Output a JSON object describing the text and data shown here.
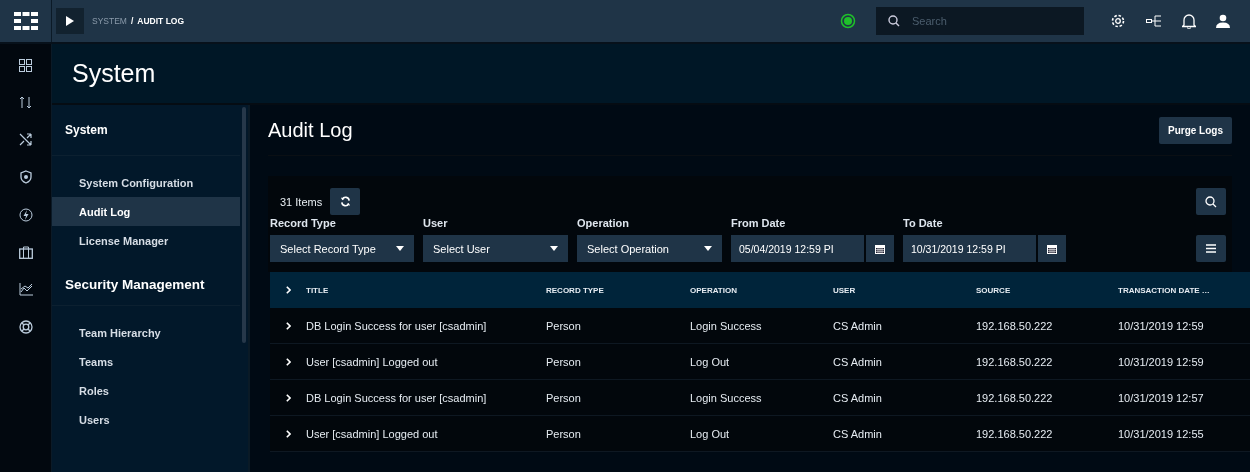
{
  "breadcrumb": {
    "parent": "SYSTEM",
    "separator": "/",
    "current": "AUDIT LOG"
  },
  "search": {
    "placeholder": "Search"
  },
  "page_title": "System",
  "sidebar": {
    "sections": [
      {
        "title": "System",
        "items": [
          {
            "label": "System Configuration",
            "selected": false
          },
          {
            "label": "Audit Log",
            "selected": true
          },
          {
            "label": "License Manager",
            "selected": false
          }
        ]
      },
      {
        "title": "Security Management",
        "items": [
          {
            "label": "Team Hierarchy",
            "selected": false
          },
          {
            "label": "Teams",
            "selected": false
          },
          {
            "label": "Roles",
            "selected": false
          },
          {
            "label": "Users",
            "selected": false
          }
        ]
      }
    ]
  },
  "content": {
    "title": "Audit Log",
    "purge_button": "Purge Logs",
    "item_count": "31 Items",
    "filters": [
      {
        "kind": "select",
        "label": "Record Type",
        "value": "Select Record Type"
      },
      {
        "kind": "select",
        "label": "User",
        "value": "Select User"
      },
      {
        "kind": "select",
        "label": "Operation",
        "value": "Select Operation"
      },
      {
        "kind": "date",
        "label": "From Date",
        "value": "05/04/2019 12:59 PI"
      },
      {
        "kind": "date",
        "label": "To Date",
        "value": "10/31/2019 12:59 PI"
      }
    ]
  },
  "table": {
    "columns": [
      "TITLE",
      "RECORD TYPE",
      "OPERATION",
      "USER",
      "SOURCE",
      "TRANSACTION DATE …"
    ],
    "rows": [
      [
        "DB Login Success for user [csadmin]",
        "Person",
        "Login Success",
        "CS Admin",
        "192.168.50.222",
        "10/31/2019 12:59"
      ],
      [
        "User [csadmin] Logged out",
        "Person",
        "Log Out",
        "CS Admin",
        "192.168.50.222",
        "10/31/2019 12:59"
      ],
      [
        "DB Login Success for user [csadmin]",
        "Person",
        "Login Success",
        "CS Admin",
        "192.168.50.222",
        "10/31/2019 12:57"
      ],
      [
        "User [csadmin] Logged out",
        "Person",
        "Log Out",
        "CS Admin",
        "192.168.50.222",
        "10/31/2019 12:55"
      ]
    ]
  }
}
